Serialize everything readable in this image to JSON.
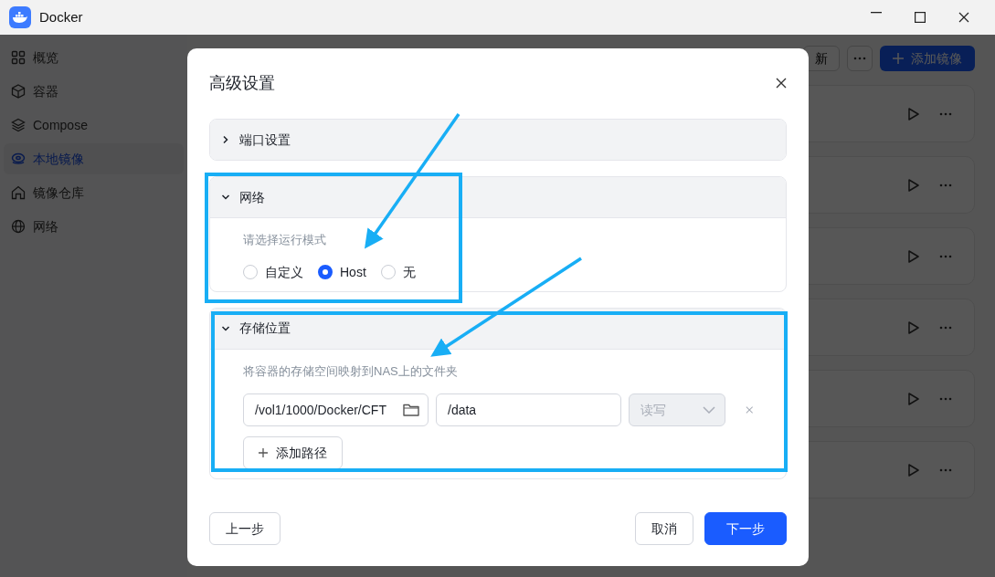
{
  "window": {
    "title": "Docker"
  },
  "sidebar": {
    "items": [
      {
        "label": "概览",
        "selected": false
      },
      {
        "label": "容器",
        "selected": false
      },
      {
        "label": "Compose",
        "selected": false
      },
      {
        "label": "本地镜像",
        "selected": true
      },
      {
        "label": "镜像仓库",
        "selected": false
      },
      {
        "label": "网络",
        "selected": false
      }
    ]
  },
  "toolbar": {
    "refresh_button": "新",
    "add_button": "添加镜像"
  },
  "dialog": {
    "title": "高级设置",
    "sections": [
      {
        "title": "端口设置",
        "expanded": false
      },
      {
        "kind": "network",
        "title": "网络",
        "expanded": true,
        "hint": "请选择运行模式",
        "options": [
          {
            "label": "自定义",
            "selected": false
          },
          {
            "label": "Host",
            "selected": true
          },
          {
            "label": "无",
            "selected": false
          }
        ]
      },
      {
        "kind": "storage",
        "title": "存储位置",
        "expanded": true,
        "hint": "将容器的存储空间映射到NAS上的文件夹",
        "mounts": [
          {
            "host_path": "/vol1/1000/Docker/CFT",
            "container_path": "/data",
            "mode": "读写",
            "mode_disabled": true
          }
        ],
        "add_button": "添加路径"
      }
    ],
    "buttons": {
      "back": "上一步",
      "cancel": "取消",
      "next": "下一步"
    }
  }
}
